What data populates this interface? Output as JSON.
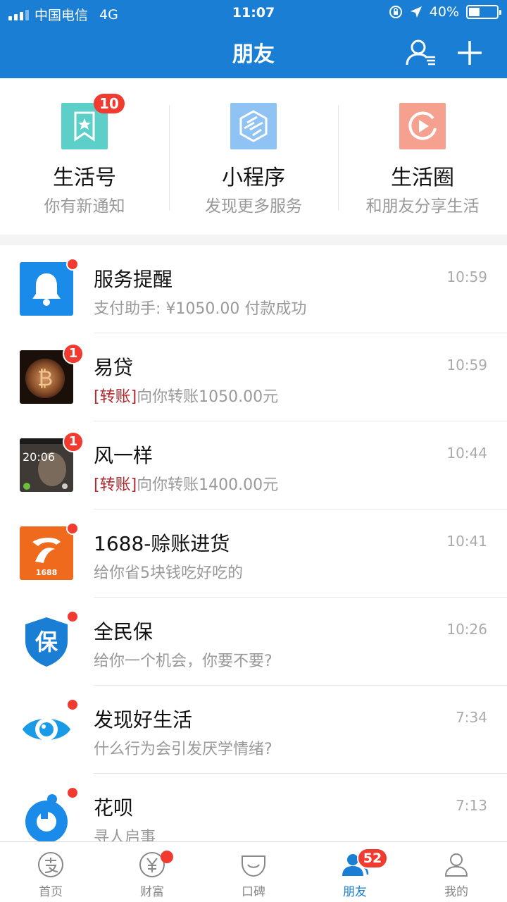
{
  "status": {
    "carrier": "中国电信",
    "network": "4G",
    "time": "11:07",
    "battery": "40%",
    "battery_level": 0.4
  },
  "header": {
    "title": "朋友"
  },
  "services": [
    {
      "name": "生活号",
      "sub": "你有新通知",
      "badge": "10",
      "color": "#5bcfc8"
    },
    {
      "name": "小程序",
      "sub": "发现更多服务",
      "badge": "",
      "color": "#8fc3f3"
    },
    {
      "name": "生活圈",
      "sub": "和朋友分享生活",
      "badge": "",
      "color": "#f6a18f"
    }
  ],
  "messages": [
    {
      "title": "服务提醒",
      "tag": "",
      "sub": "支付助手: ¥1050.00 付款成功",
      "time": "10:59",
      "badge": "",
      "avatar": "bell-icon"
    },
    {
      "title": "易贷",
      "tag": "[转账]",
      "sub": "向你转账1050.00元",
      "time": "10:59",
      "badge": "1",
      "avatar": "bitcoin-photo"
    },
    {
      "title": "风一样",
      "tag": "[转账]",
      "sub": "向你转账1400.00元",
      "time": "10:44",
      "badge": "1",
      "avatar": "phone-photo",
      "avatar_text": "20:06"
    },
    {
      "title": "1688-赊账进货",
      "tag": "",
      "sub": "给你省5块钱吃好吃的",
      "time": "10:41",
      "badge": "",
      "avatar": "1688-logo",
      "avatar_text": "1688"
    },
    {
      "title": "全民保",
      "tag": "",
      "sub": "给你一个机会，你要不要?",
      "time": "10:26",
      "badge": "",
      "avatar": "shield-logo",
      "avatar_text": "保"
    },
    {
      "title": "发现好生活",
      "tag": "",
      "sub": "什么行为会引发厌学情绪?",
      "time": "7:34",
      "badge": "",
      "avatar": "eye-logo"
    },
    {
      "title": "花呗",
      "tag": "",
      "sub": "寻人启事",
      "time": "7:13",
      "badge": "",
      "avatar": "huabei-logo"
    }
  ],
  "tabs": [
    {
      "label": "首页",
      "icon": "alipay-icon",
      "badge": ""
    },
    {
      "label": "财富",
      "icon": "yen-icon",
      "badge": "dot"
    },
    {
      "label": "口碑",
      "icon": "koubei-icon",
      "badge": ""
    },
    {
      "label": "朋友",
      "icon": "friends-icon",
      "badge": "52"
    },
    {
      "label": "我的",
      "icon": "person-icon",
      "badge": ""
    }
  ],
  "colors": {
    "brand": "#1a7fd4",
    "badge": "#f23b30",
    "tag": "#b3282d"
  }
}
